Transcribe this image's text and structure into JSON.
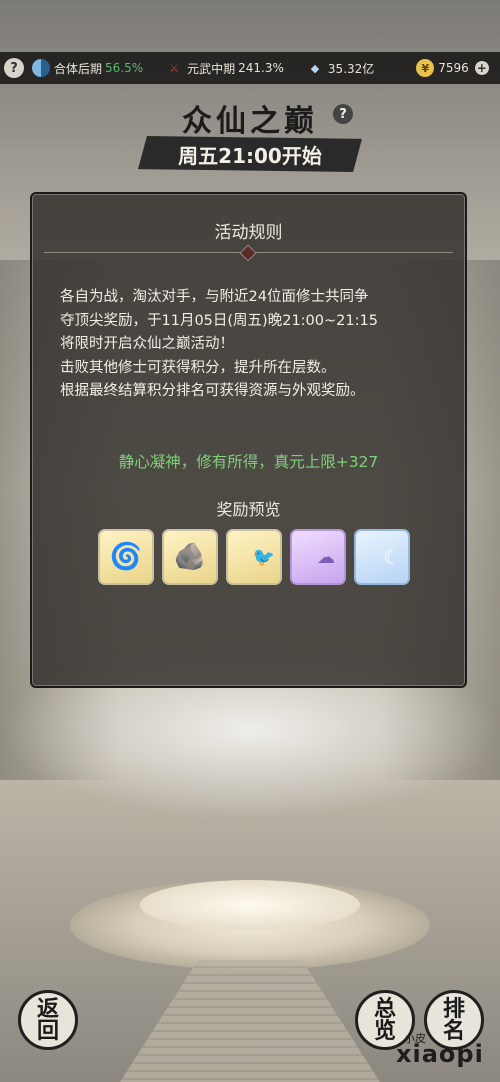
{
  "topbar": {
    "help_icon": "?",
    "realm_label": "合体后期",
    "realm_pct": "56.5%",
    "martial_label": "元武中期",
    "martial_pct": "241.3%",
    "crystal_value": "35.32亿",
    "coin_value": "7596",
    "plus_icon": "+"
  },
  "header": {
    "title": "众仙之巅",
    "help_icon": "?",
    "start_time": "周五21:00开始"
  },
  "panel": {
    "title": "活动规则",
    "rules": [
      "各自为战，淘汰对手，与附近24位面修士共同争",
      "夺顶尖奖励，于11月05日(周五)晚21:00~21:15",
      "将限时开启众仙之巅活动！",
      "击败其他修士可获得积分，提升所在层数。",
      "根据最终结算积分排名可获得资源与外观奖励。"
    ],
    "bonus": "静心凝神，修有所得，真元上限+327",
    "reward_title": "奖励预览",
    "rewards": [
      {
        "icon": "swirl-stone-icon",
        "glyph": "🌀"
      },
      {
        "icon": "ore-icon",
        "glyph": "🪨"
      },
      {
        "icon": "scroll-icon",
        "glyph": "🐦"
      },
      {
        "icon": "purple-frame-icon",
        "glyph": "☁"
      },
      {
        "icon": "blue-frame-icon",
        "glyph": "☾"
      }
    ]
  },
  "buttons": {
    "back_1": "返",
    "back_2": "回",
    "overview_1": "总",
    "overview_2": "览",
    "rank_1": "排",
    "rank_2": "名"
  },
  "watermark": {
    "small": "小皮",
    "large": "xiaopi"
  }
}
